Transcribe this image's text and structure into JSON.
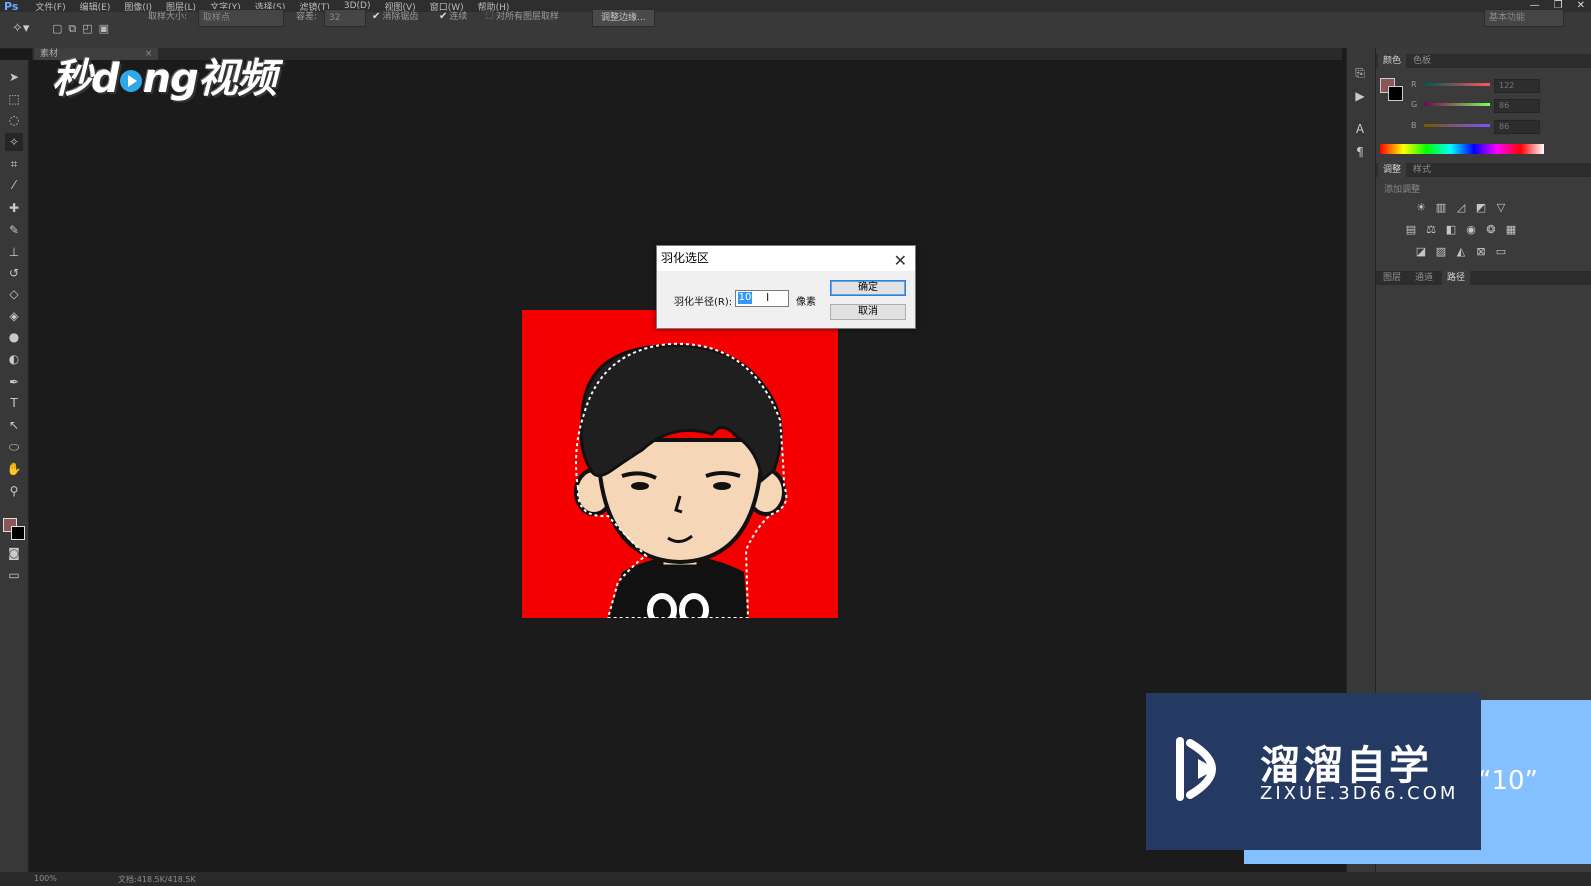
{
  "app": {
    "logo": "Ps"
  },
  "menu": [
    "文件(F)",
    "编辑(E)",
    "图像(I)",
    "图层(L)",
    "文字(Y)",
    "选择(S)",
    "滤镜(T)",
    "3D(D)",
    "视图(V)",
    "窗口(W)",
    "帮助(H)"
  ],
  "window_controls": [
    "—",
    "❐",
    "✕"
  ],
  "options": {
    "sample_size_label": "取样大小:",
    "sample_size_value": "取样点",
    "tolerance_label": "容差:",
    "tolerance_value": "32",
    "antialias_label": "消除锯齿",
    "antialias_checked": true,
    "contiguous_label": "连续",
    "contiguous_checked": true,
    "all_layers_label": "对所有图层取样",
    "all_layers_checked": false,
    "refine_edge_button": "调整边缘...",
    "workspace": "基本功能"
  },
  "document_tab": {
    "label": "素材"
  },
  "tools": [
    "move-tool",
    "marquee-tool",
    "lasso-tool",
    "magic-wand-tool",
    "crop-tool",
    "eyedropper-tool",
    "healing-tool",
    "brush-tool",
    "stamp-tool",
    "history-brush-tool",
    "eraser-tool",
    "bucket-tool",
    "blur-tool",
    "dodge-tool",
    "pen-tool",
    "type-tool",
    "path-select-tool",
    "shape-tool",
    "hand-tool",
    "zoom-tool"
  ],
  "colors": {
    "foreground": "#8c5656",
    "background": "#000000",
    "image_bg": "#f40000",
    "accent_blue": "#253a63"
  },
  "color_panel": {
    "tabs": [
      "颜色",
      "色板"
    ],
    "channels": [
      {
        "name": "R",
        "value": "122"
      },
      {
        "name": "G",
        "value": "86"
      },
      {
        "name": "B",
        "value": "86"
      }
    ]
  },
  "adjust_panel": {
    "tabs": [
      "调整",
      "样式"
    ],
    "heading": "添加调整"
  },
  "layers_panel": {
    "tabs": [
      "图层",
      "通道",
      "路径"
    ],
    "active_tab": "路径"
  },
  "dialog": {
    "title": "羽化选区",
    "radius_label": "羽化半径(R):",
    "radius_value": "10",
    "unit": "像素",
    "ok_label": "确定",
    "cancel_label": "取消"
  },
  "status": {
    "zoom": "100%",
    "doc_info": "文档:418.5K/418.5K"
  },
  "watermark_top": {
    "pre": "秒d",
    "post": "ng视频"
  },
  "callout": {
    "text": "“10”"
  },
  "zixue": {
    "name": "溜溜自学",
    "url": "ZIXUE.3D66.COM"
  }
}
